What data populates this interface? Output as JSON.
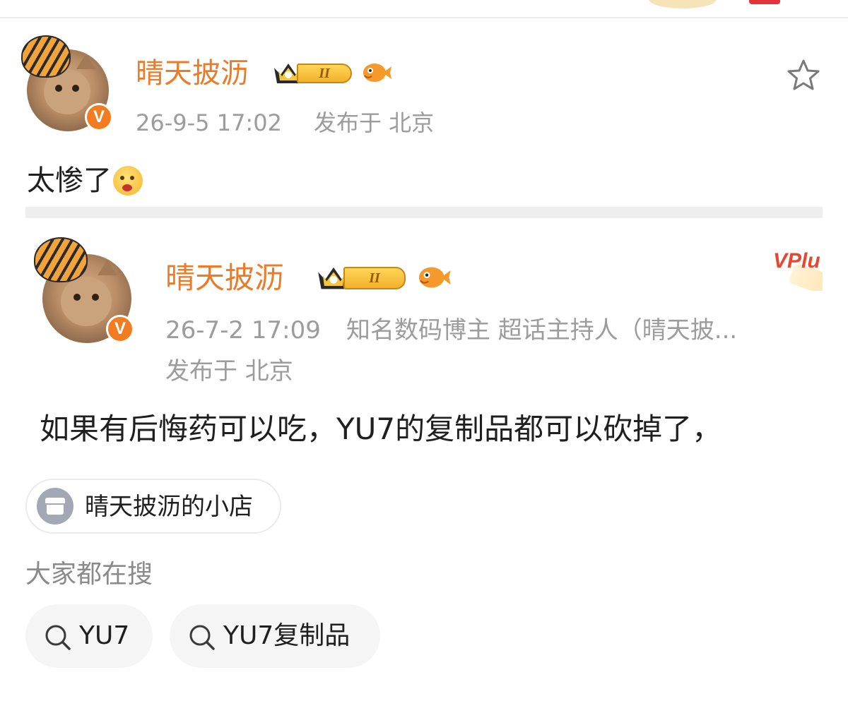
{
  "post": {
    "author": "晴天披沥",
    "level_badge": "II",
    "verified_mark": "V",
    "time": "26-9-5 17:02",
    "location": "发布于 北京",
    "text": "太惨了",
    "emoji": "sad-face-emoji"
  },
  "repost": {
    "author": "晴天披沥",
    "level_badge": "II",
    "verified_mark": "V",
    "time": "26-7-2 17:09",
    "bio": "知名数码博主 超话主持人（晴天披...",
    "location": "发布于 北京",
    "vplus_badge": "VPlu",
    "text": "如果有后悔药可以吃，YU7的复制品都可以砍掉了，"
  },
  "shop": {
    "label": "晴天披沥的小店"
  },
  "trending": {
    "heading": "大家都在搜",
    "chips": [
      "YU7",
      "YU7复制品"
    ]
  },
  "colors": {
    "username": "#ec7a27",
    "verified": "#f47c20",
    "meta": "#9c9c9c"
  }
}
